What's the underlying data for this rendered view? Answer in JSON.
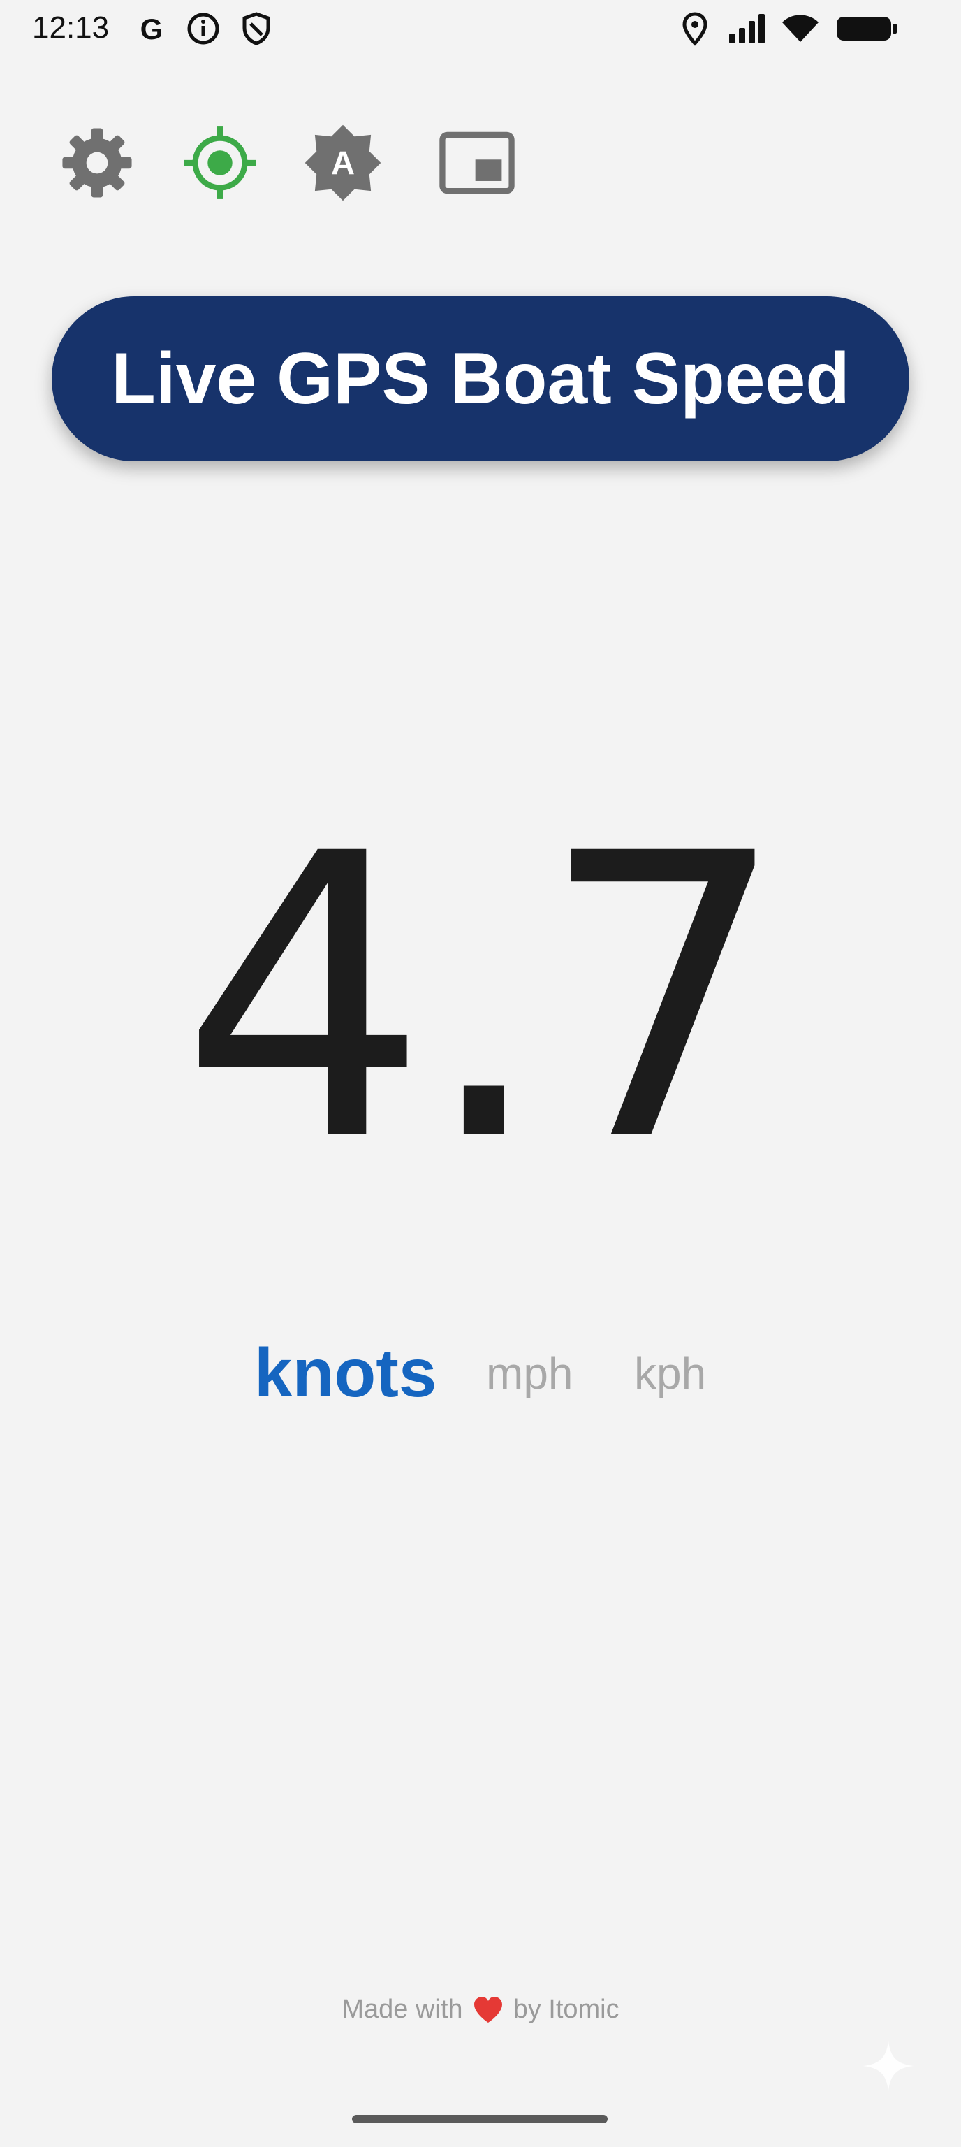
{
  "status_bar": {
    "time": "12:13",
    "icons": [
      "google-icon",
      "info-icon",
      "shield-icon",
      "location-icon",
      "signal-icon",
      "wifi-icon",
      "battery-icon"
    ]
  },
  "toolbar": {
    "buttons": [
      {
        "icon": "gear-icon",
        "color": "#707070"
      },
      {
        "icon": "gps-target-icon",
        "color": "#3daa48"
      },
      {
        "icon": "auto-brightness-icon",
        "color": "#707070"
      },
      {
        "icon": "picture-in-picture-icon",
        "color": "#707070"
      }
    ]
  },
  "title": "Live GPS Boat Speed",
  "speed": {
    "value": "4.7"
  },
  "units": {
    "options": [
      "knots",
      "mph",
      "kph"
    ],
    "selected": "knots",
    "selected_color": "#1565c0",
    "inactive_color": "#a8a8a8"
  },
  "footer": {
    "prefix": "Made with",
    "suffix": "by Itomic",
    "heart_color": "#e53935"
  },
  "colors": {
    "title_bg": "#17336b",
    "background": "#f3f3f3"
  }
}
